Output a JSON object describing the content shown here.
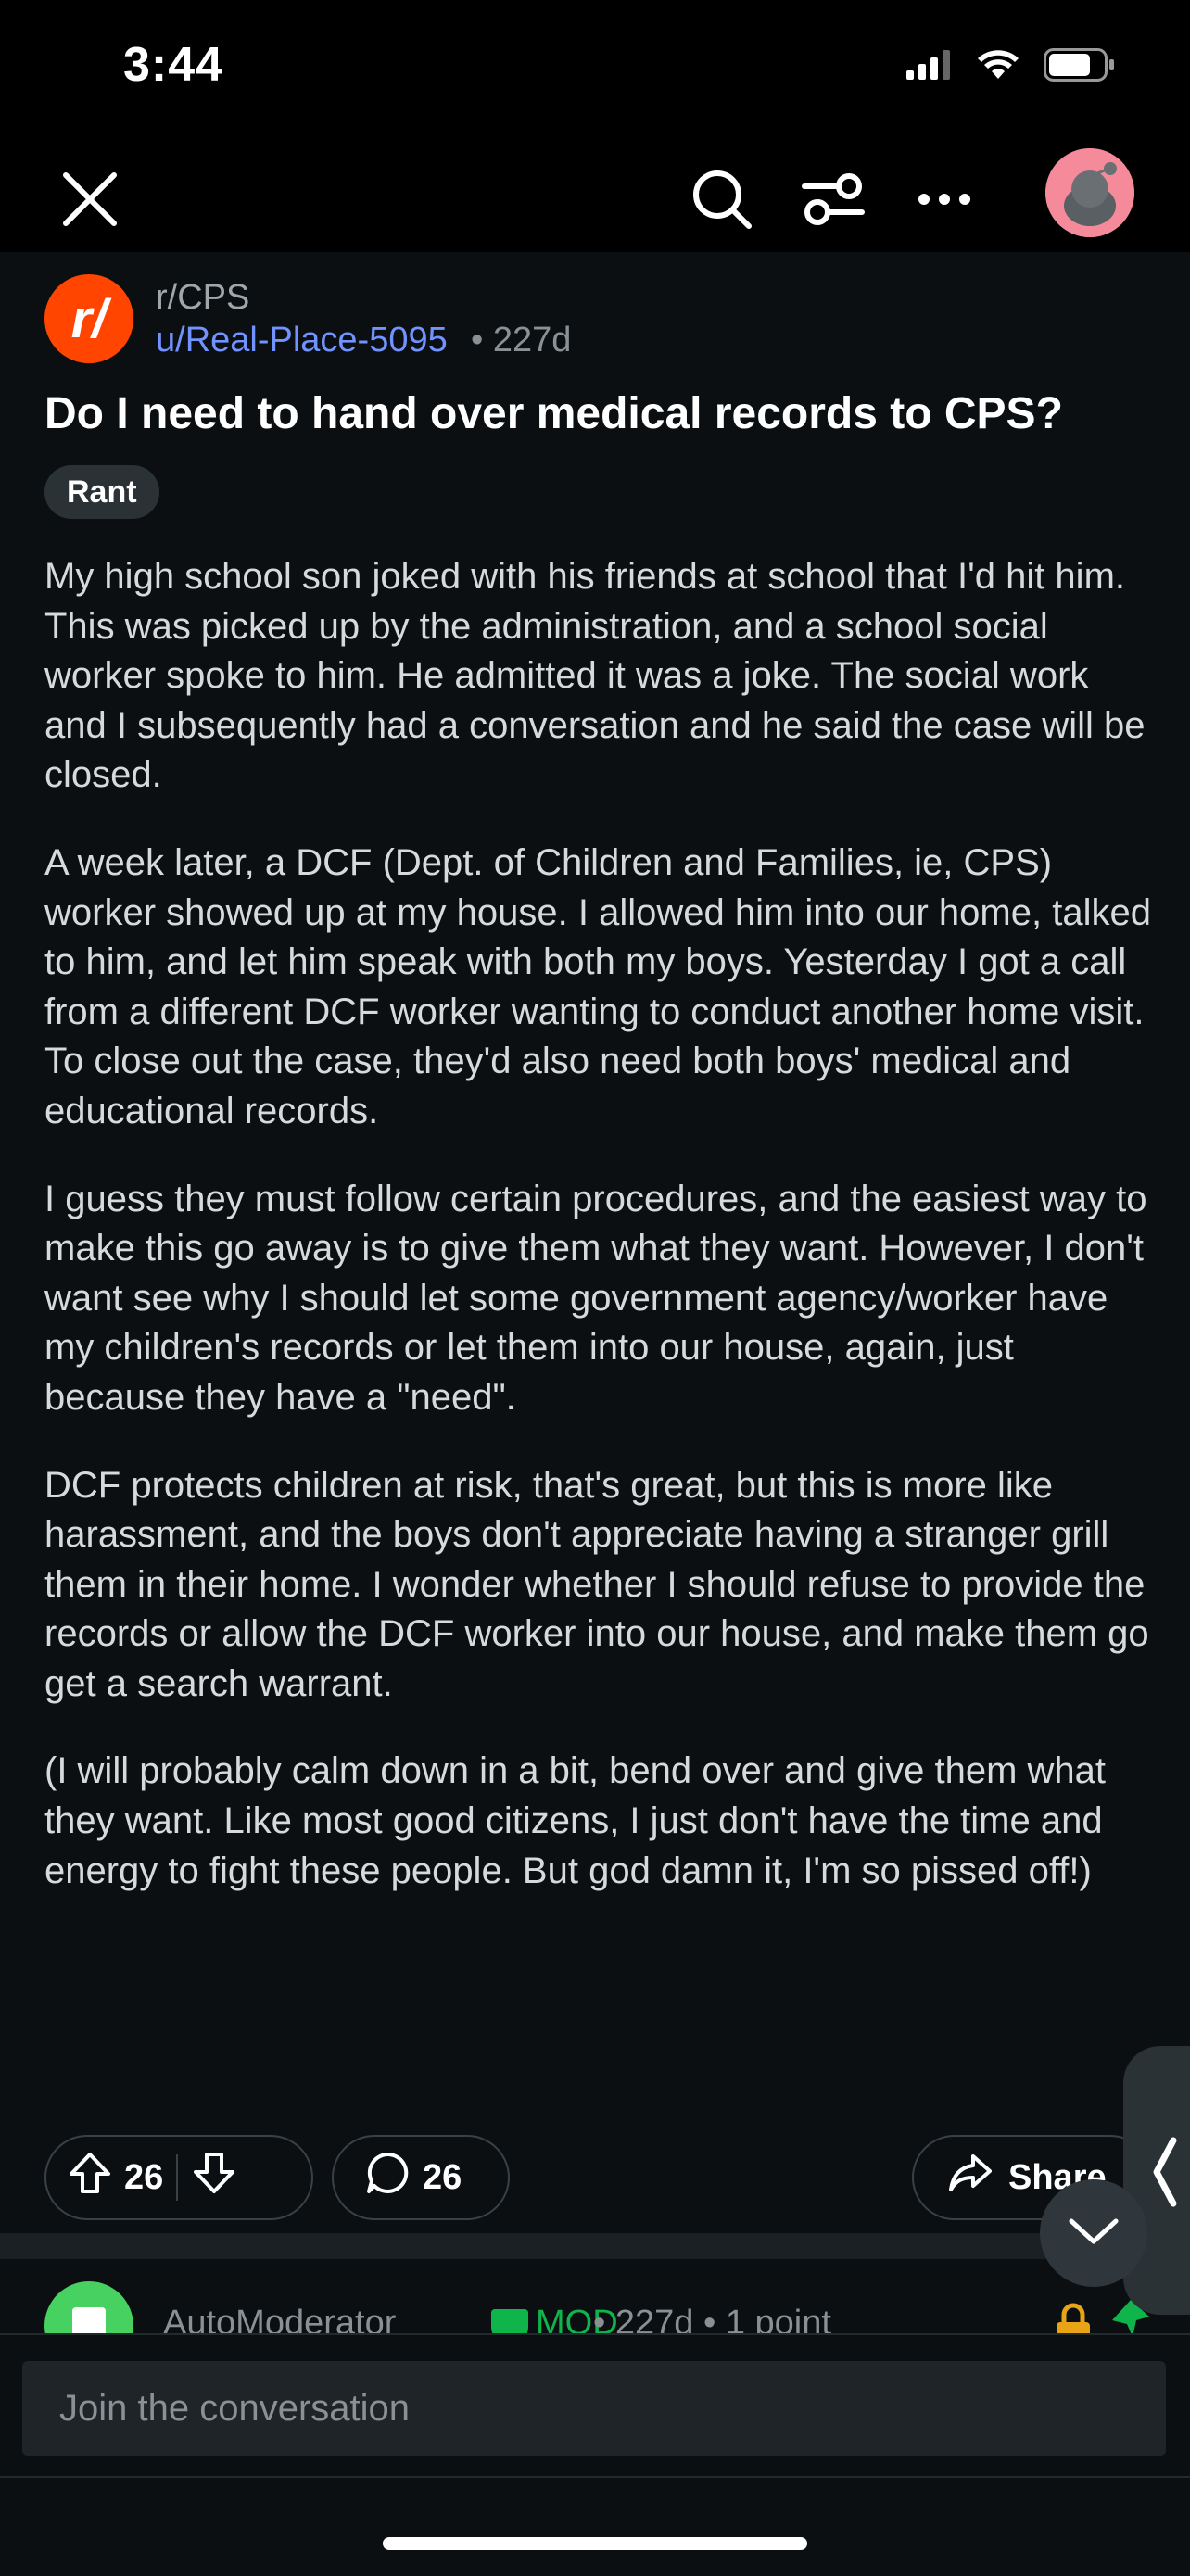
{
  "status_bar": {
    "time": "3:44",
    "icons": [
      "cellular-icon",
      "wifi-icon",
      "battery-icon"
    ]
  },
  "nav": {
    "icons": [
      "close-icon",
      "search-icon",
      "filter-icon",
      "more-icon",
      "profile-avatar"
    ]
  },
  "post": {
    "subreddit": "r/CPS",
    "subreddit_icon_text": "r/",
    "author": "u/Real-Place-5095",
    "age": "• 227d",
    "title": "Do I need to hand over medical records to CPS?",
    "flair": "Rant",
    "paragraphs": [
      "My high school son joked with his friends at school that I'd hit him. This was picked up by the administration, and a school social worker spoke to him. He admitted it was a joke. The social work and I subsequently had a conversation and he said the case will be closed.",
      "A week later, a DCF (Dept. of Children and Families, ie, CPS) worker showed up at my house. I allowed him into our home, talked to him, and let him speak with both my boys. Yesterday I got a call from a different DCF worker wanting to conduct another home visit. To close out the case, they'd also need both boys' medical and educational records.",
      "I guess they must follow certain procedures, and the easiest way to make this go away is to give them what they want. However, I don't want see why I should let some government agency/worker have my children's records or let them into our house, again, just because they have a \"need\".",
      "DCF protects children at risk, that's great, but this is more like harassment, and the boys don't appreciate having a stranger grill them in their home. I wonder whether I should refuse to provide the records or allow the DCF worker into our house, and make them go get a search warrant.",
      "(I will probably calm down in a bit, bend over and give them what they want. Like most good citizens, I just don't have the time and energy to fight these people. But god damn it, I'm so pissed off!)"
    ],
    "upvotes": "26",
    "comments": "26",
    "share_label": "Share"
  },
  "comment_preview": {
    "author": "AutoModerator",
    "mod_label": "MOD",
    "meta": "• 227d • 1 point"
  },
  "composer": {
    "placeholder": "Join the conversation"
  },
  "colors": {
    "accent_subreddit": "#ff4500",
    "link": "#7193ff",
    "mod": "#0fb44a",
    "background": "#0b0f12"
  }
}
